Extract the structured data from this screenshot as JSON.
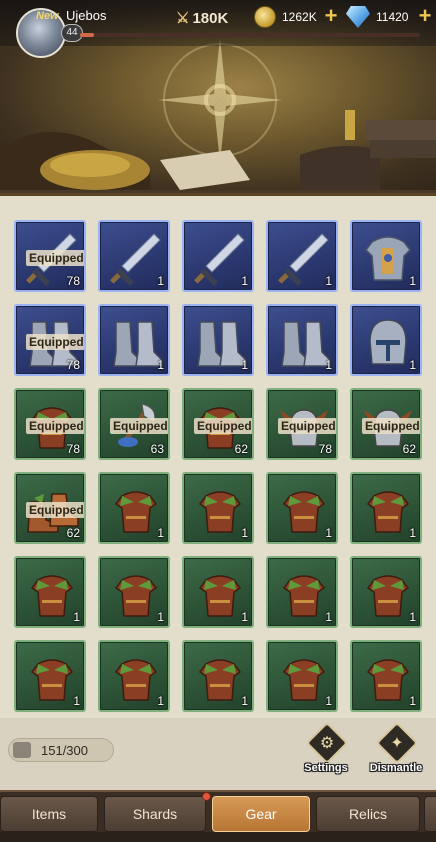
{
  "header": {
    "new_tag": "New",
    "player_name": "Ujebos",
    "level": "44",
    "power": "180K",
    "gold": "1262K",
    "gems": "11420",
    "xp_fraction": 0.04
  },
  "inventory": {
    "rows": [
      [
        {
          "kind": "sword",
          "rarity": "blue",
          "equipped": true,
          "count": "78"
        },
        {
          "kind": "sword",
          "rarity": "blue",
          "equipped": false,
          "count": "1"
        },
        {
          "kind": "sword",
          "rarity": "blue",
          "equipped": false,
          "count": "1"
        },
        {
          "kind": "sword",
          "rarity": "blue",
          "equipped": false,
          "count": "1"
        },
        {
          "kind": "armor",
          "rarity": "blue",
          "equipped": false,
          "count": "1"
        }
      ],
      [
        {
          "kind": "boots",
          "rarity": "blue",
          "equipped": true,
          "count": "78"
        },
        {
          "kind": "boots",
          "rarity": "blue",
          "equipped": false,
          "count": "1"
        },
        {
          "kind": "boots",
          "rarity": "blue",
          "equipped": false,
          "count": "1"
        },
        {
          "kind": "boots",
          "rarity": "blue",
          "equipped": false,
          "count": "1"
        },
        {
          "kind": "helmet",
          "rarity": "blue",
          "equipped": false,
          "count": "1"
        }
      ],
      [
        {
          "kind": "leather",
          "rarity": "green",
          "equipped": true,
          "count": "78"
        },
        {
          "kind": "axe",
          "rarity": "green",
          "equipped": true,
          "count": "63"
        },
        {
          "kind": "leather",
          "rarity": "green",
          "equipped": true,
          "count": "62"
        },
        {
          "kind": "horned-helm",
          "rarity": "green",
          "equipped": true,
          "count": "78"
        },
        {
          "kind": "horned-helm",
          "rarity": "green",
          "equipped": true,
          "count": "62"
        }
      ],
      [
        {
          "kind": "shoes",
          "rarity": "green",
          "equipped": true,
          "count": "62"
        },
        {
          "kind": "leather",
          "rarity": "green",
          "equipped": false,
          "count": "1"
        },
        {
          "kind": "leather",
          "rarity": "green",
          "equipped": false,
          "count": "1"
        },
        {
          "kind": "leather",
          "rarity": "green",
          "equipped": false,
          "count": "1"
        },
        {
          "kind": "leather",
          "rarity": "green",
          "equipped": false,
          "count": "1"
        }
      ],
      [
        {
          "kind": "leather",
          "rarity": "green",
          "equipped": false,
          "count": "1"
        },
        {
          "kind": "leather",
          "rarity": "green",
          "equipped": false,
          "count": "1"
        },
        {
          "kind": "leather",
          "rarity": "green",
          "equipped": false,
          "count": "1"
        },
        {
          "kind": "leather",
          "rarity": "green",
          "equipped": false,
          "count": "1"
        },
        {
          "kind": "leather",
          "rarity": "green",
          "equipped": false,
          "count": "1"
        }
      ],
      [
        {
          "kind": "leather",
          "rarity": "green",
          "equipped": false,
          "count": "1"
        },
        {
          "kind": "leather",
          "rarity": "green",
          "equipped": false,
          "count": "1"
        },
        {
          "kind": "leather",
          "rarity": "green",
          "equipped": false,
          "count": "1"
        },
        {
          "kind": "leather",
          "rarity": "green",
          "equipped": false,
          "count": "1"
        },
        {
          "kind": "leather",
          "rarity": "green",
          "equipped": false,
          "count": "1"
        }
      ]
    ],
    "equipped_label": "Equipped"
  },
  "footer": {
    "capacity": "151/300",
    "settings_label": "Settings",
    "dismantle_label": "Dismantle"
  },
  "tabs": [
    {
      "label": "Items",
      "active": false
    },
    {
      "label": "Shards",
      "active": false
    },
    {
      "label": "Gear",
      "active": true
    },
    {
      "label": "Relics",
      "active": false
    }
  ],
  "colors": {
    "blue_slot": "#2b3870",
    "green_slot": "#2c5236",
    "active_tab": "#c98446"
  }
}
